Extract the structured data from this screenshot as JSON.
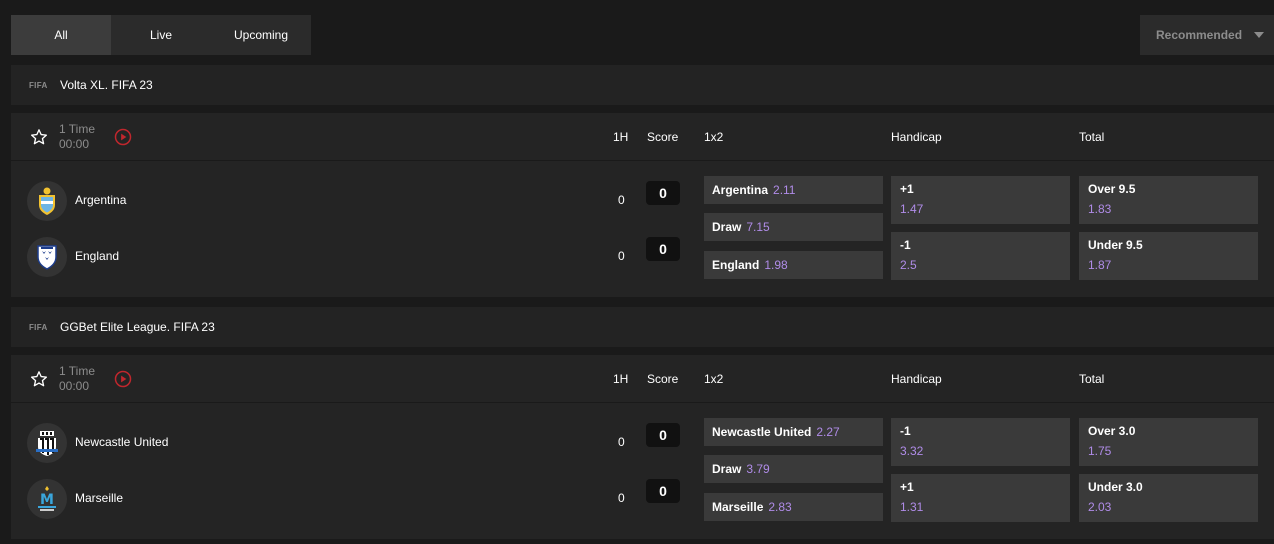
{
  "filters": {
    "tabs": [
      {
        "label": "All"
      },
      {
        "label": "Live"
      },
      {
        "label": "Upcoming"
      }
    ],
    "sort_label": "Recommended"
  },
  "columns": {
    "half": "1H",
    "score": "Score",
    "onex2": "1x2",
    "handicap": "Handicap",
    "total": "Total"
  },
  "leagues": [
    {
      "tag": "FIFA",
      "name": "Volta XL. FIFA 23",
      "match": {
        "period": "1 Time",
        "clock": "00:00",
        "home": {
          "name": "Argentina",
          "half": "0",
          "score": "0"
        },
        "away": {
          "name": "England",
          "half": "0",
          "score": "0"
        },
        "onex2": [
          {
            "label": "Argentina",
            "odd": "2.11"
          },
          {
            "label": "Draw",
            "odd": "7.15"
          },
          {
            "label": "England",
            "odd": "1.98"
          }
        ],
        "handicap": [
          {
            "label": "+1",
            "odd": "1.47"
          },
          {
            "label": "-1",
            "odd": "2.5"
          }
        ],
        "total": [
          {
            "label": "Over 9.5",
            "odd": "1.83"
          },
          {
            "label": "Under 9.5",
            "odd": "1.87"
          }
        ]
      }
    },
    {
      "tag": "FIFA",
      "name": "GGBet Elite League. FIFA 23",
      "match": {
        "period": "1 Time",
        "clock": "00:00",
        "home": {
          "name": "Newcastle United",
          "half": "0",
          "score": "0"
        },
        "away": {
          "name": "Marseille",
          "half": "0",
          "score": "0"
        },
        "onex2": [
          {
            "label": "Newcastle United",
            "odd": "2.27"
          },
          {
            "label": "Draw",
            "odd": "3.79"
          },
          {
            "label": "Marseille",
            "odd": "2.83"
          }
        ],
        "handicap": [
          {
            "label": "-1",
            "odd": "3.32"
          },
          {
            "label": "+1",
            "odd": "1.31"
          }
        ],
        "total": [
          {
            "label": "Over 3.0",
            "odd": "1.75"
          },
          {
            "label": "Under 3.0",
            "odd": "2.03"
          }
        ]
      }
    }
  ],
  "colors": {
    "background": "#1a1a1a",
    "panel": "#242424",
    "odd_button": "#3a3a3a",
    "odd_value": "#b08ce8",
    "live_icon": "#c0272d",
    "muted_text": "#8c8c8c"
  }
}
